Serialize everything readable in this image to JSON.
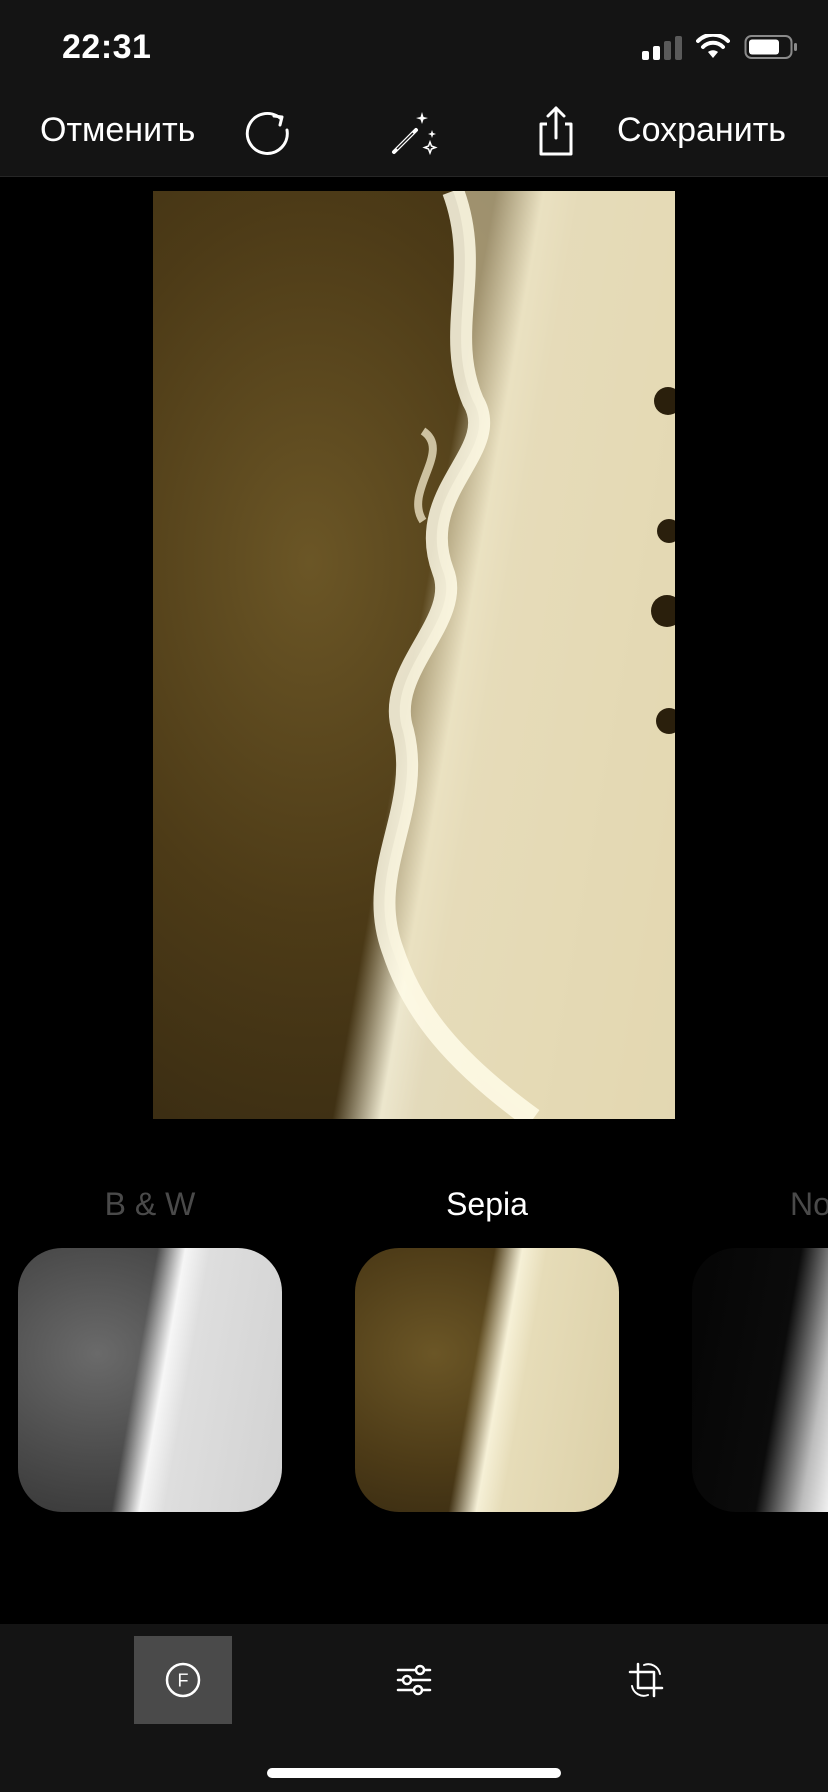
{
  "status_bar": {
    "time": "22:31",
    "icons": [
      "cellular-signal-icon",
      "wifi-icon",
      "battery-icon"
    ]
  },
  "toolbar": {
    "cancel_label": "Отменить",
    "save_label": "Сохранить",
    "icons": [
      "reset-icon",
      "magic-wand-icon",
      "share-icon"
    ]
  },
  "editor": {
    "selected_filter": "Sepia"
  },
  "filters": [
    {
      "label": "B & W",
      "selected": false
    },
    {
      "label": "Sepia",
      "selected": true
    },
    {
      "label": "No",
      "selected": false
    }
  ],
  "tabs": [
    {
      "icon": "filters-icon",
      "glyph": "F",
      "selected": true
    },
    {
      "icon": "sliders-icon",
      "selected": false
    },
    {
      "icon": "crop-rotate-icon",
      "selected": false
    }
  ],
  "colors": {
    "background": "#000000",
    "bar_background": "#141414",
    "selected_tab": "#4a4a4a",
    "inactive_label": "#4a4a4a",
    "active_label": "#ffffff"
  }
}
